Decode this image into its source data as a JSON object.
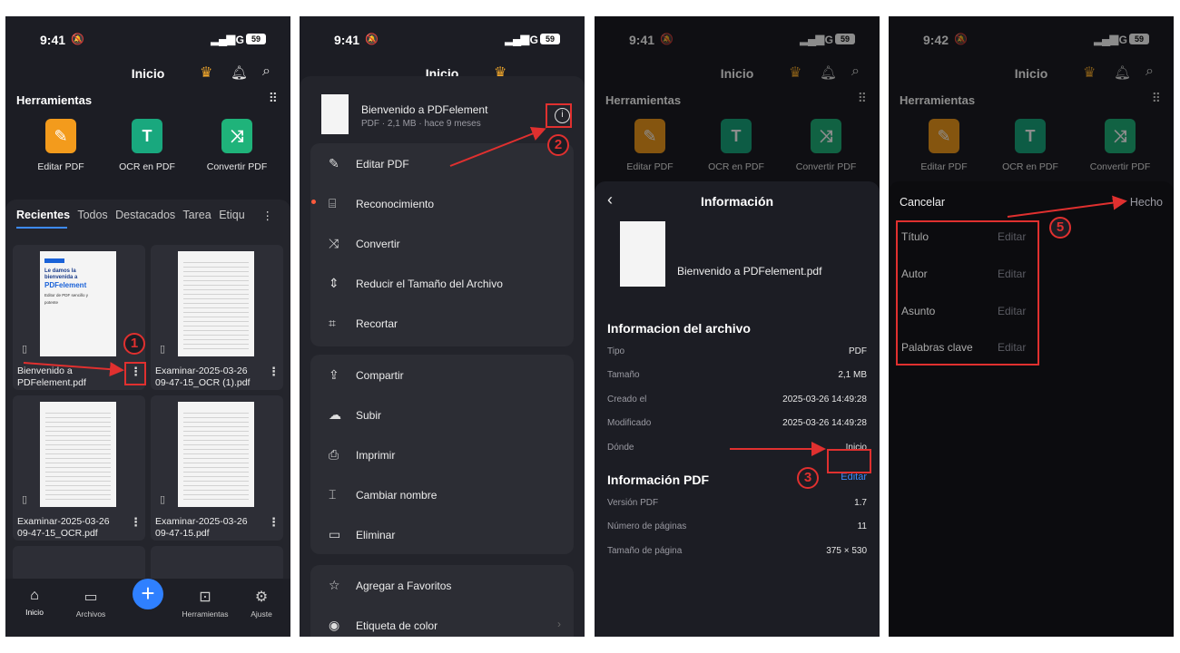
{
  "status": {
    "time_a": "9:41",
    "time_b": "9:42",
    "network": "5G",
    "battery": "59"
  },
  "header": {
    "title": "Inicio"
  },
  "tools": {
    "heading": "Herramientas",
    "items": [
      {
        "label": "Editar PDF",
        "icon": "edit-pdf-icon",
        "color": "#f39b1c"
      },
      {
        "label": "OCR en PDF",
        "icon": "ocr-icon",
        "color": "#19a87e"
      },
      {
        "label": "Convertir PDF",
        "icon": "convert-icon",
        "color": "#1fb37a"
      }
    ]
  },
  "recents": {
    "tabs": [
      "Recientes",
      "Todos",
      "Destacados",
      "Tarea",
      "Etiqu"
    ],
    "files": [
      {
        "line1": "Bienvenido a",
        "line2": "PDFelement.pdf"
      },
      {
        "line1": "Examinar-2025-03-26",
        "line2": "09-47-15_OCR (1).pdf"
      },
      {
        "line1": "Examinar-2025-03-26",
        "line2": "09-47-15_OCR.pdf"
      },
      {
        "line1": "Examinar-2025-03-26",
        "line2": "09-47-15.pdf"
      }
    ],
    "thumb_text": {
      "h1a": "Le damos la",
      "h1b": "bienvenida a",
      "h2": "PDFelement",
      "sub1": "Editor de PDF sencillo y",
      "sub2": "potente"
    }
  },
  "bottom_nav": [
    "Inicio",
    "Archivos",
    "Herramientas",
    "Ajuste"
  ],
  "file_menu": {
    "file_name": "Bienvenido a PDFelement",
    "file_meta": "PDF · 2,1 MB · hace 9 meses",
    "group1": [
      "Editar PDF",
      "Reconocimiento",
      "Convertir",
      "Reducir el Tamaño del Archivo",
      "Recortar"
    ],
    "group2": [
      "Compartir",
      "Subir",
      "Imprimir",
      "Cambiar nombre",
      "Eliminar"
    ],
    "group3": [
      "Agregar a Favoritos",
      "Etiqueta de color"
    ]
  },
  "info": {
    "title": "Información",
    "file_name": "Bienvenido a PDFelement.pdf",
    "file_section": "Informacion del archivo",
    "file_rows": [
      {
        "k": "Tipo",
        "v": "PDF"
      },
      {
        "k": "Tamaño",
        "v": "2,1 MB"
      },
      {
        "k": "Creado el",
        "v": "2025-03-26 14:49:28"
      },
      {
        "k": "Modificado",
        "v": "2025-03-26 14:49:28"
      },
      {
        "k": "Dónde",
        "v": "Inicio"
      }
    ],
    "pdf_section": "Información PDF",
    "edit_label": "Editar",
    "pdf_rows": [
      {
        "k": "Versión PDF",
        "v": "1.7"
      },
      {
        "k": "Número de páginas",
        "v": "11"
      },
      {
        "k": "Tamaño de página",
        "v": "375 × 530"
      }
    ]
  },
  "edit_props": {
    "cancel": "Cancelar",
    "done": "Hecho",
    "placeholder": "Editar",
    "fields": [
      "Título",
      "Autor",
      "Asunto",
      "Palabras clave"
    ]
  },
  "steps": [
    "1",
    "2",
    "3",
    "5"
  ],
  "colors": {
    "accent": "#3d8bfd",
    "annotation": "#e0302f",
    "crown": "#f0a72c"
  }
}
